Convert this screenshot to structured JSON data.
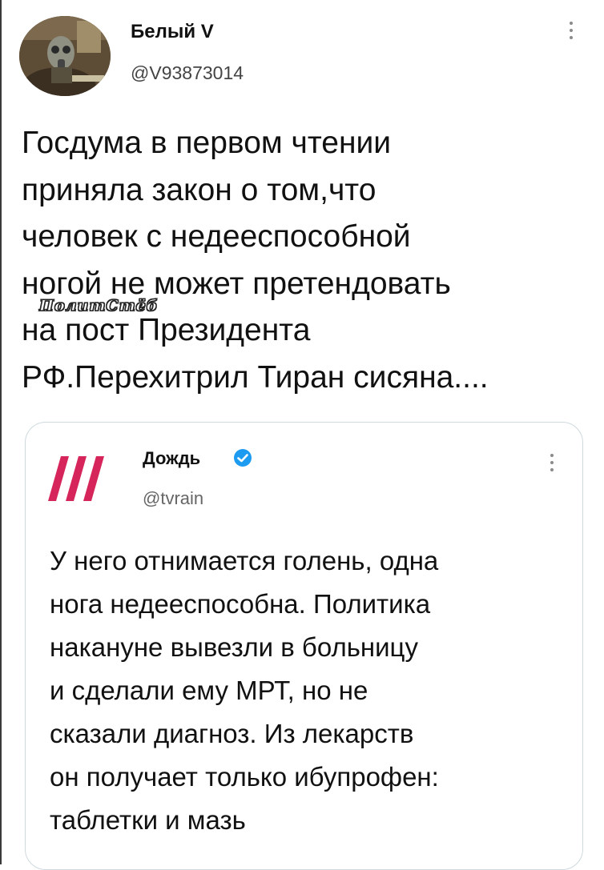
{
  "tweet": {
    "author_name": "Белый V",
    "author_handle": "@V93873014",
    "text_lines": [
      "Госдума в первом чтении",
      "приняла закон о том,что",
      "человек с недееспособной",
      "ногой не может претендовать",
      "на пост Президента",
      "РФ.Перехитрил Тиран сисяна...."
    ],
    "watermark": "ПолитСтёб",
    "avatar_icon": "gasmask-figure-avatar",
    "menu_icon": "more-vertical-icon"
  },
  "quote": {
    "author_name": "Дождь",
    "author_handle": "@tvrain",
    "verified_icon": "verified-badge-icon",
    "verified_color": "#1d9bf0",
    "logo_color": "#d5255a",
    "text_lines": [
      "У него отнимается голень, одна",
      "нога недееспособна. Политика",
      "накануне вывезли в больницу",
      "и сделали ему МРТ, но не",
      "сказали диагноз. Из лекарств",
      "он получает только ибупрофен:",
      "таблетки и мазь"
    ]
  }
}
